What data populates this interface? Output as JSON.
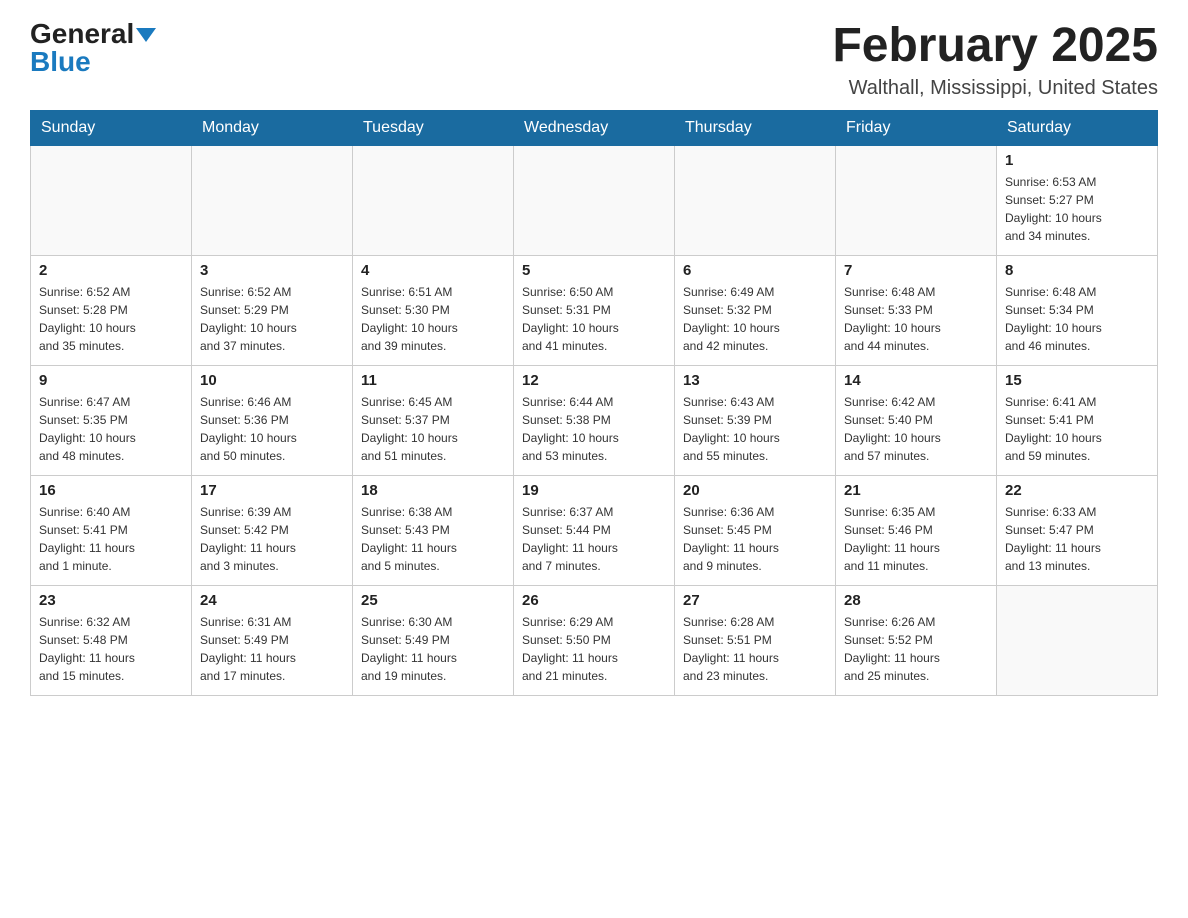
{
  "header": {
    "logo_general": "General",
    "logo_blue": "Blue",
    "month_title": "February 2025",
    "location": "Walthall, Mississippi, United States"
  },
  "weekdays": [
    "Sunday",
    "Monday",
    "Tuesday",
    "Wednesday",
    "Thursday",
    "Friday",
    "Saturday"
  ],
  "weeks": [
    [
      {
        "day": "",
        "info": ""
      },
      {
        "day": "",
        "info": ""
      },
      {
        "day": "",
        "info": ""
      },
      {
        "day": "",
        "info": ""
      },
      {
        "day": "",
        "info": ""
      },
      {
        "day": "",
        "info": ""
      },
      {
        "day": "1",
        "info": "Sunrise: 6:53 AM\nSunset: 5:27 PM\nDaylight: 10 hours\nand 34 minutes."
      }
    ],
    [
      {
        "day": "2",
        "info": "Sunrise: 6:52 AM\nSunset: 5:28 PM\nDaylight: 10 hours\nand 35 minutes."
      },
      {
        "day": "3",
        "info": "Sunrise: 6:52 AM\nSunset: 5:29 PM\nDaylight: 10 hours\nand 37 minutes."
      },
      {
        "day": "4",
        "info": "Sunrise: 6:51 AM\nSunset: 5:30 PM\nDaylight: 10 hours\nand 39 minutes."
      },
      {
        "day": "5",
        "info": "Sunrise: 6:50 AM\nSunset: 5:31 PM\nDaylight: 10 hours\nand 41 minutes."
      },
      {
        "day": "6",
        "info": "Sunrise: 6:49 AM\nSunset: 5:32 PM\nDaylight: 10 hours\nand 42 minutes."
      },
      {
        "day": "7",
        "info": "Sunrise: 6:48 AM\nSunset: 5:33 PM\nDaylight: 10 hours\nand 44 minutes."
      },
      {
        "day": "8",
        "info": "Sunrise: 6:48 AM\nSunset: 5:34 PM\nDaylight: 10 hours\nand 46 minutes."
      }
    ],
    [
      {
        "day": "9",
        "info": "Sunrise: 6:47 AM\nSunset: 5:35 PM\nDaylight: 10 hours\nand 48 minutes."
      },
      {
        "day": "10",
        "info": "Sunrise: 6:46 AM\nSunset: 5:36 PM\nDaylight: 10 hours\nand 50 minutes."
      },
      {
        "day": "11",
        "info": "Sunrise: 6:45 AM\nSunset: 5:37 PM\nDaylight: 10 hours\nand 51 minutes."
      },
      {
        "day": "12",
        "info": "Sunrise: 6:44 AM\nSunset: 5:38 PM\nDaylight: 10 hours\nand 53 minutes."
      },
      {
        "day": "13",
        "info": "Sunrise: 6:43 AM\nSunset: 5:39 PM\nDaylight: 10 hours\nand 55 minutes."
      },
      {
        "day": "14",
        "info": "Sunrise: 6:42 AM\nSunset: 5:40 PM\nDaylight: 10 hours\nand 57 minutes."
      },
      {
        "day": "15",
        "info": "Sunrise: 6:41 AM\nSunset: 5:41 PM\nDaylight: 10 hours\nand 59 minutes."
      }
    ],
    [
      {
        "day": "16",
        "info": "Sunrise: 6:40 AM\nSunset: 5:41 PM\nDaylight: 11 hours\nand 1 minute."
      },
      {
        "day": "17",
        "info": "Sunrise: 6:39 AM\nSunset: 5:42 PM\nDaylight: 11 hours\nand 3 minutes."
      },
      {
        "day": "18",
        "info": "Sunrise: 6:38 AM\nSunset: 5:43 PM\nDaylight: 11 hours\nand 5 minutes."
      },
      {
        "day": "19",
        "info": "Sunrise: 6:37 AM\nSunset: 5:44 PM\nDaylight: 11 hours\nand 7 minutes."
      },
      {
        "day": "20",
        "info": "Sunrise: 6:36 AM\nSunset: 5:45 PM\nDaylight: 11 hours\nand 9 minutes."
      },
      {
        "day": "21",
        "info": "Sunrise: 6:35 AM\nSunset: 5:46 PM\nDaylight: 11 hours\nand 11 minutes."
      },
      {
        "day": "22",
        "info": "Sunrise: 6:33 AM\nSunset: 5:47 PM\nDaylight: 11 hours\nand 13 minutes."
      }
    ],
    [
      {
        "day": "23",
        "info": "Sunrise: 6:32 AM\nSunset: 5:48 PM\nDaylight: 11 hours\nand 15 minutes."
      },
      {
        "day": "24",
        "info": "Sunrise: 6:31 AM\nSunset: 5:49 PM\nDaylight: 11 hours\nand 17 minutes."
      },
      {
        "day": "25",
        "info": "Sunrise: 6:30 AM\nSunset: 5:49 PM\nDaylight: 11 hours\nand 19 minutes."
      },
      {
        "day": "26",
        "info": "Sunrise: 6:29 AM\nSunset: 5:50 PM\nDaylight: 11 hours\nand 21 minutes."
      },
      {
        "day": "27",
        "info": "Sunrise: 6:28 AM\nSunset: 5:51 PM\nDaylight: 11 hours\nand 23 minutes."
      },
      {
        "day": "28",
        "info": "Sunrise: 6:26 AM\nSunset: 5:52 PM\nDaylight: 11 hours\nand 25 minutes."
      },
      {
        "day": "",
        "info": ""
      }
    ]
  ]
}
